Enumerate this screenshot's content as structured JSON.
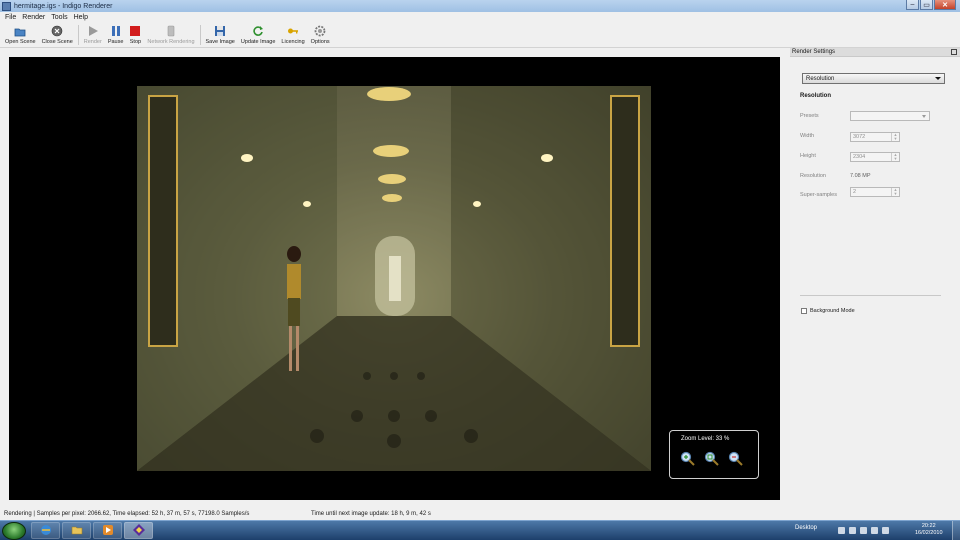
{
  "window": {
    "title": "hermitage.igs - Indigo Renderer",
    "buttons": [
      "–",
      "▭",
      "✕"
    ]
  },
  "menu": [
    "File",
    "Render",
    "Tools",
    "Help"
  ],
  "toolbar": [
    {
      "label": "Open Scene",
      "icon": "folder-icon",
      "enabled": true
    },
    {
      "label": "Close Scene",
      "icon": "close-scene-icon",
      "enabled": true
    },
    {
      "label": "Render",
      "icon": "play-icon",
      "enabled": false
    },
    {
      "label": "Pause",
      "icon": "pause-icon",
      "enabled": true
    },
    {
      "label": "Stop",
      "icon": "stop-icon",
      "enabled": true
    },
    {
      "label": "Network Rendering",
      "icon": "network-icon",
      "enabled": false
    },
    {
      "label": "Save Image",
      "icon": "floppy-icon",
      "enabled": true
    },
    {
      "label": "Update Image",
      "icon": "refresh-icon",
      "enabled": true
    },
    {
      "label": "Licencing",
      "icon": "key-icon",
      "enabled": true
    },
    {
      "label": "Options",
      "icon": "gear-icon",
      "enabled": true
    }
  ],
  "render_view": {
    "zoom_label": "Zoom Level: 33 %",
    "zoom_buttons": [
      "zoom-in-icon",
      "zoom-fit-icon",
      "zoom-out-icon"
    ]
  },
  "panel": {
    "title": "Render Settings",
    "dropdown": "Resolution",
    "section": "Resolution",
    "presets_label": "Presets",
    "presets_value": "",
    "width_label": "Width",
    "width_value": "3072",
    "height_label": "Height",
    "height_value": "2304",
    "resolution_label": "Resolution",
    "resolution_value": "7.08 MP",
    "supersamples_label": "Super-samples",
    "supersamples_value": "2",
    "background_mode_label": "Background Mode",
    "background_mode_checked": false
  },
  "status": {
    "left": "Rendering | Samples per pixel: 2066.62, Time elapsed: 52 h, 37 m, 57 s, 77198.0 Samples/s",
    "right": "Time until next image update: 18 h, 9 m, 42 s"
  },
  "taskbar": {
    "desktop_label": "Desktop",
    "time": "20:22",
    "date": "16/02/2010"
  }
}
